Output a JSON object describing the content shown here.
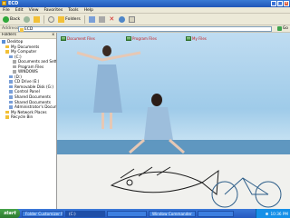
{
  "window": {
    "title": "ECD"
  },
  "menu": [
    "File",
    "Edit",
    "View",
    "Favorites",
    "Tools",
    "Help"
  ],
  "toolbar": {
    "back": "Back",
    "folders": "Folders"
  },
  "address": {
    "label": "Address",
    "value": "ECD",
    "go": "Go"
  },
  "left_pane": {
    "title": "Folders",
    "close": "x",
    "tree": [
      {
        "label": "Desktop",
        "level": 0
      },
      {
        "label": "My Documents",
        "level": 1
      },
      {
        "label": "My Computer",
        "level": 1
      },
      {
        "label": "(C:)",
        "level": 2
      },
      {
        "label": "Documents and Settings",
        "level": 3
      },
      {
        "label": "Program Files",
        "level": 3
      },
      {
        "label": "WINDOWS",
        "level": 3
      },
      {
        "label": "(D:)",
        "level": 2
      },
      {
        "label": "CD Drive (E:)",
        "level": 2
      },
      {
        "label": "Removable Disk (G:)",
        "level": 2
      },
      {
        "label": "Control Panel",
        "level": 2
      },
      {
        "label": "Shared Documents",
        "level": 2
      },
      {
        "label": "Shared Documents",
        "level": 2
      },
      {
        "label": "Administrator's Documents",
        "level": 2
      },
      {
        "label": "My Network Places",
        "level": 1
      },
      {
        "label": "Recycle Bin",
        "level": 1
      }
    ]
  },
  "desktop_icons": [
    {
      "label": "Document Files",
      "color": "#c4181a"
    },
    {
      "label": "Program Files",
      "color": "#c4181a"
    },
    {
      "label": "My Files",
      "color": "#c4181a"
    }
  ],
  "taskbar": {
    "start": "start",
    "tasks": [
      {
        "label": "Folder Customizer P"
      },
      {
        "label": "(C:)"
      },
      {
        "label": ""
      },
      {
        "label": "Window Commander"
      },
      {
        "label": ""
      }
    ],
    "clock": "10:36 PM"
  }
}
